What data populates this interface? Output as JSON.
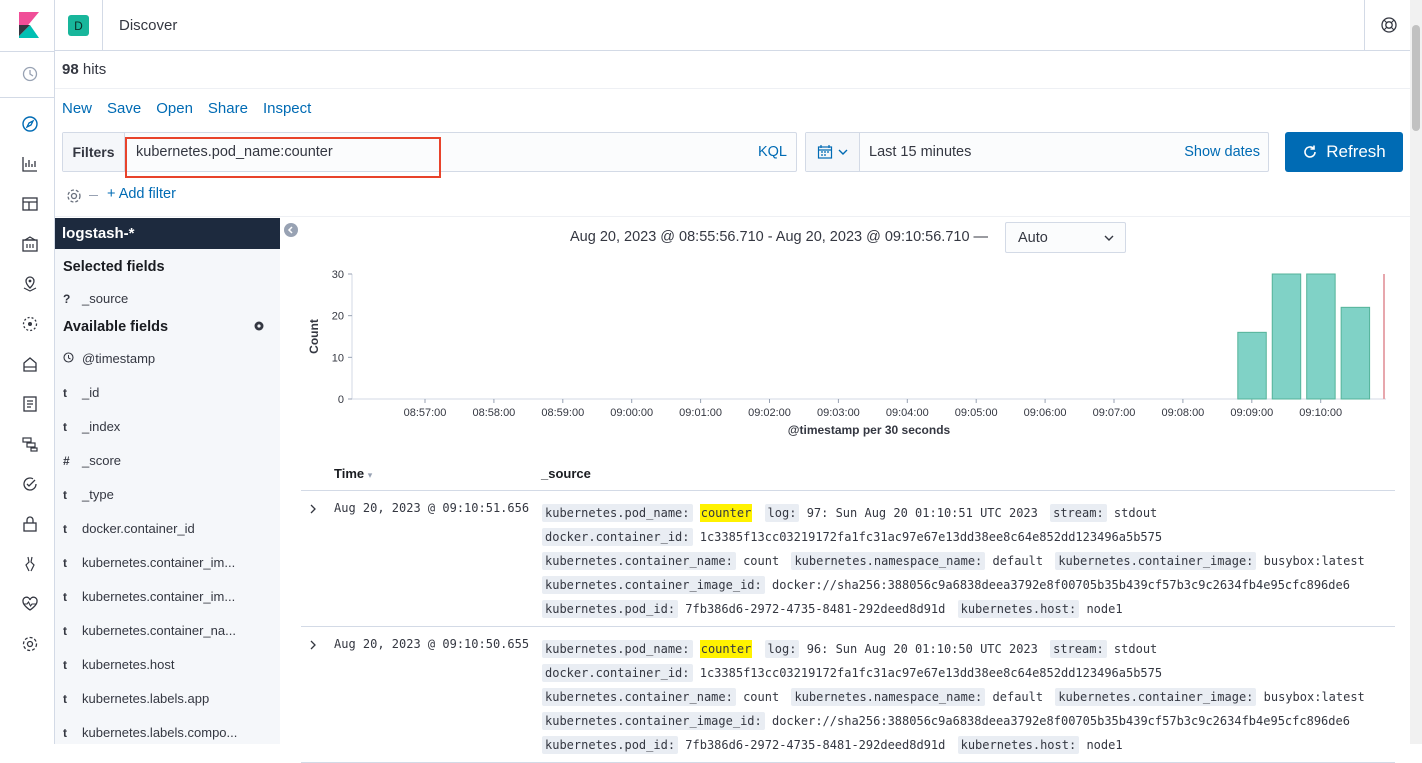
{
  "header": {
    "space_initial": "D",
    "title": "Discover"
  },
  "hits": {
    "count": "98",
    "label": "hits"
  },
  "top_menu": [
    "New",
    "Save",
    "Open",
    "Share",
    "Inspect"
  ],
  "query": {
    "filters_label": "Filters",
    "value": "kubernetes.pod_name:counter",
    "language": "KQL"
  },
  "datepicker": {
    "range": "Last 15 minutes",
    "show_dates": "Show dates"
  },
  "refresh_label": "Refresh",
  "add_filter": "+ Add filter",
  "sidebar": {
    "index_pattern": "logstash-*",
    "selected_heading": "Selected fields",
    "selected": [
      {
        "type": "?",
        "name": "_source"
      }
    ],
    "available_heading": "Available fields",
    "available": [
      {
        "type": "clock",
        "name": "@timestamp"
      },
      {
        "type": "t",
        "name": "_id"
      },
      {
        "type": "t",
        "name": "_index"
      },
      {
        "type": "#",
        "name": "_score"
      },
      {
        "type": "t",
        "name": "_type"
      },
      {
        "type": "t",
        "name": "docker.container_id"
      },
      {
        "type": "t",
        "name": "kubernetes.container_im..."
      },
      {
        "type": "t",
        "name": "kubernetes.container_im..."
      },
      {
        "type": "t",
        "name": "kubernetes.container_na..."
      },
      {
        "type": "t",
        "name": "kubernetes.host"
      },
      {
        "type": "t",
        "name": "kubernetes.labels.app"
      },
      {
        "type": "t",
        "name": "kubernetes.labels.compo..."
      }
    ]
  },
  "chart_header": {
    "range_text": "Aug 20, 2023 @ 08:55:56.710 - Aug 20, 2023 @ 09:10:56.710 —",
    "interval": "Auto"
  },
  "chart_data": {
    "type": "bar",
    "ylabel": "Count",
    "xlabel": "@timestamp per 30 seconds",
    "ylim": [
      0,
      30
    ],
    "yticks": [
      0,
      10,
      20,
      30
    ],
    "xticks": [
      "08:57:00",
      "08:58:00",
      "08:59:00",
      "09:00:00",
      "09:01:00",
      "09:02:00",
      "09:03:00",
      "09:04:00",
      "09:05:00",
      "09:06:00",
      "09:07:00",
      "09:08:00",
      "09:09:00",
      "09:10:00"
    ],
    "categories": [
      "09:09:00",
      "09:09:30",
      "09:10:00",
      "09:10:30"
    ],
    "values": [
      16,
      30,
      30,
      22
    ],
    "bar_color": "#80d2c6",
    "bar_stroke": "#54b399",
    "now_marker_color": "#e7a7ad"
  },
  "table": {
    "columns": [
      "Time",
      "_source"
    ],
    "rows": [
      {
        "time": "Aug 20, 2023 @ 09:10:51.656",
        "fields": [
          {
            "k": "kubernetes.pod_name:",
            "v": "counter",
            "hl": true
          },
          {
            "k": "log:",
            "v": "97: Sun Aug 20 01:10:51 UTC 2023"
          },
          {
            "k": "stream:",
            "v": "stdout"
          },
          {
            "k": "docker.container_id:",
            "v": "1c3385f13cc03219172fa1fc31ac97e67e13dd38ee8c64e852dd123496a5b575"
          },
          {
            "k": "kubernetes.container_name:",
            "v": "count"
          },
          {
            "k": "kubernetes.namespace_name:",
            "v": "default"
          },
          {
            "k": "kubernetes.container_image:",
            "v": "busybox:latest"
          },
          {
            "k": "kubernetes.container_image_id:",
            "v": "docker://sha256:388056c9a6838deea3792e8f00705b35b439cf57b3c9c2634fb4e95cfc896de6"
          },
          {
            "k": "kubernetes.pod_id:",
            "v": "7fb386d6-2972-4735-8481-292deed8d91d"
          },
          {
            "k": "kubernetes.host:",
            "v": "node1"
          }
        ]
      },
      {
        "time": "Aug 20, 2023 @ 09:10:50.655",
        "fields": [
          {
            "k": "kubernetes.pod_name:",
            "v": "counter",
            "hl": true
          },
          {
            "k": "log:",
            "v": "96: Sun Aug 20 01:10:50 UTC 2023"
          },
          {
            "k": "stream:",
            "v": "stdout"
          },
          {
            "k": "docker.container_id:",
            "v": "1c3385f13cc03219172fa1fc31ac97e67e13dd38ee8c64e852dd123496a5b575"
          },
          {
            "k": "kubernetes.container_name:",
            "v": "count"
          },
          {
            "k": "kubernetes.namespace_name:",
            "v": "default"
          },
          {
            "k": "kubernetes.container_image:",
            "v": "busybox:latest"
          },
          {
            "k": "kubernetes.container_image_id:",
            "v": "docker://sha256:388056c9a6838deea3792e8f00705b35b439cf57b3c9c2634fb4e95cfc896de6"
          },
          {
            "k": "kubernetes.pod_id:",
            "v": "7fb386d6-2972-4735-8481-292deed8d91d"
          },
          {
            "k": "kubernetes.host:",
            "v": "node1"
          }
        ]
      }
    ]
  },
  "icons": {
    "nav": [
      "recent-icon",
      "discover-icon",
      "visualize-icon",
      "dashboard-icon",
      "canvas-icon",
      "maps-icon",
      "ml-icon",
      "infrastructure-icon",
      "logs-icon",
      "apm-icon",
      "uptime-icon",
      "security-icon",
      "dev-tools-icon",
      "monitoring-icon",
      "management-icon"
    ]
  }
}
